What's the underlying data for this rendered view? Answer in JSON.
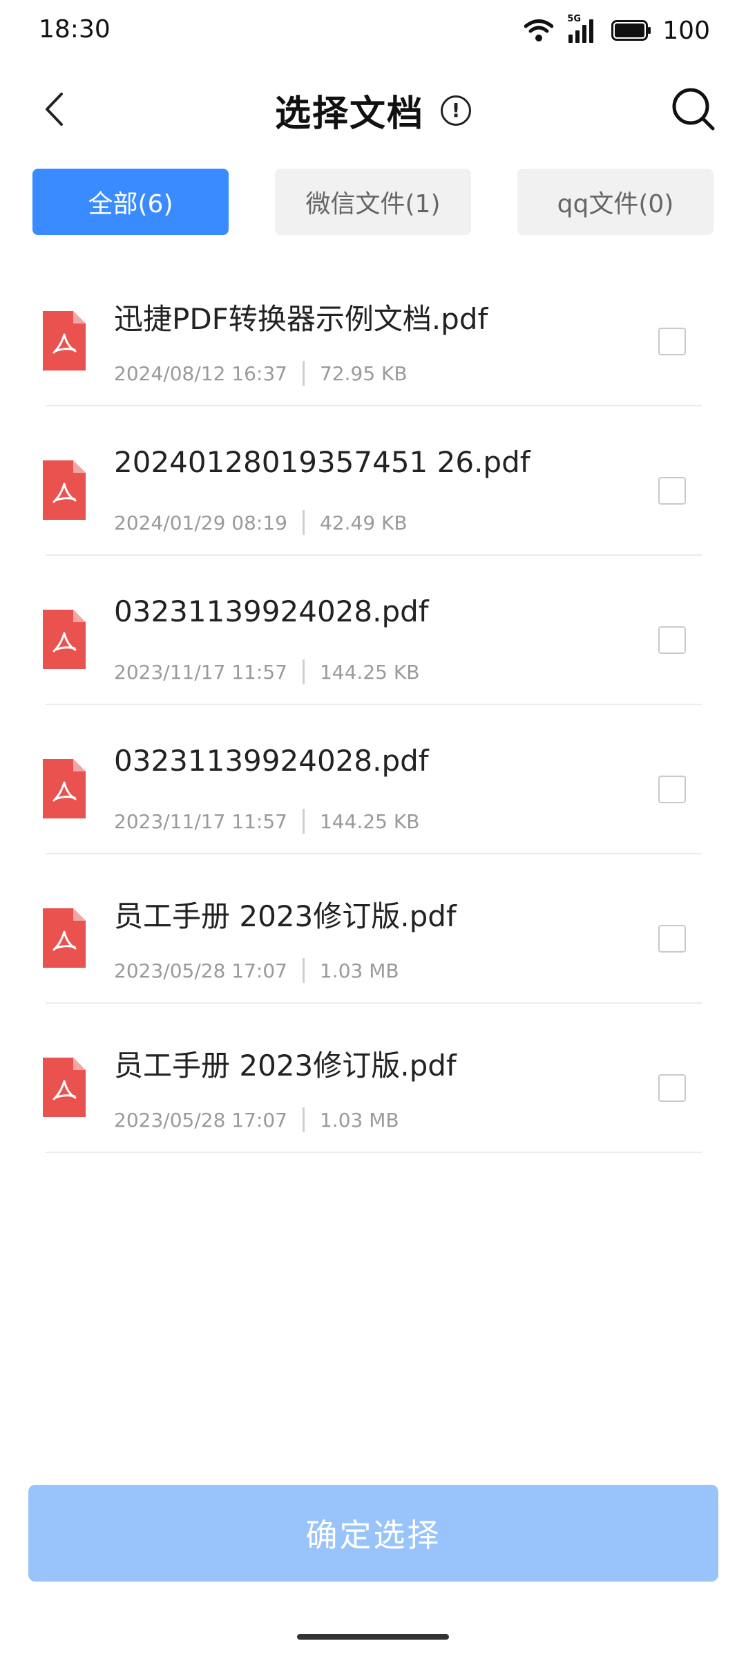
{
  "status_bar": {
    "time": "18:30",
    "network_label": "5G",
    "battery": "100"
  },
  "header": {
    "title": "选择文档",
    "info_glyph": "!"
  },
  "tabs": [
    {
      "label": "全部(6)",
      "active": true
    },
    {
      "label": "微信文件(1)",
      "active": false
    },
    {
      "label": "qq文件(0)",
      "active": false
    }
  ],
  "files": [
    {
      "name": "迅捷PDF转换器示例文档.pdf",
      "date": "2024/08/12 16:37",
      "size": "72.95 KB",
      "checked": false
    },
    {
      "name": "20240128019357451 26.pdf",
      "date": "2024/01/29 08:19",
      "size": "42.49 KB",
      "checked": false
    },
    {
      "name": "03231139924028.pdf",
      "date": "2023/11/17 11:57",
      "size": "144.25 KB",
      "checked": false
    },
    {
      "name": "03231139924028.pdf",
      "date": "2023/11/17 11:57",
      "size": "144.25 KB",
      "checked": false
    },
    {
      "name": "员工手册 2023修订版.pdf",
      "date": "2023/05/28 17:07",
      "size": "1.03 MB",
      "checked": false
    },
    {
      "name": "员工手册 2023修订版.pdf",
      "date": "2023/05/28 17:07",
      "size": "1.03 MB",
      "checked": false
    }
  ],
  "confirm_button": {
    "label": "确定选择",
    "enabled": false
  },
  "colors": {
    "accent": "#3a8bff",
    "confirm_disabled": "#99c4fb",
    "pdf_red": "#e9524f"
  },
  "icons": {
    "back": "chevron-left-icon",
    "info": "info-circle-icon",
    "search": "search-icon",
    "file": "pdf-file-icon",
    "wifi": "wifi-icon",
    "signal": "signal-icon",
    "battery": "battery-icon"
  }
}
